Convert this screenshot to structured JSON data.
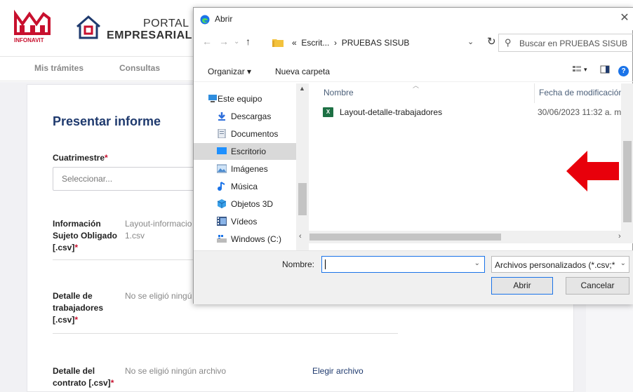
{
  "portal": {
    "title_line1": "PORTAL",
    "title_line2": "EMPRESARIAL",
    "logo_text": "INFONAVIT"
  },
  "nav": {
    "items": [
      "Mis trámites",
      "Consultas"
    ]
  },
  "form": {
    "title": "Presentar informe",
    "cuatrimestre_label": "Cuatrimestre",
    "cuatrimestre_placeholder": "Seleccionar...",
    "info_label_l1": "Información",
    "info_label_l2": "Sujeto Obligado",
    "info_label_l3": "[.csv]",
    "info_value_l1": "Layout-informacio",
    "info_value_l2": "1.csv",
    "detalle_trab_l1": "Detalle de",
    "detalle_trab_l2": "trabajadores",
    "detalle_trab_l3": "[.csv]",
    "detalle_trab_value": "No se eligió ningú",
    "detalle_contrato_l1": "Detalle del",
    "detalle_contrato_l2": "contrato [.csv]",
    "detalle_contrato_value": "No se eligió ningún archivo",
    "elegir_archivo": "Elegir archivo",
    "required_mark": "*"
  },
  "dialog": {
    "title": "Abrir",
    "close": "✕",
    "path_prefix": "«",
    "path_folder": "Escrit...",
    "path_sep": "›",
    "path_current": "PRUEBAS SISUB",
    "search_placeholder": "Buscar en PRUEBAS SISUB",
    "toolbar": {
      "organizar": "Organizar ▾",
      "nueva_carpeta": "Nueva carpeta",
      "help": "?"
    },
    "tree": [
      "Este equipo",
      "Descargas",
      "Documentos",
      "Escritorio",
      "Imágenes",
      "Música",
      "Objetos 3D",
      "Vídeos",
      "Windows (C:)"
    ],
    "columns": {
      "nombre": "Nombre",
      "fecha": "Fecha de modificación"
    },
    "files": [
      {
        "name": "Layout-detalle-trabajadores",
        "date": "30/06/2023 11:32 a. m"
      }
    ],
    "filename_label": "Nombre:",
    "filename_value": "",
    "filetype": "Archivos personalizados (*.csv;*",
    "open_button": "Abrir",
    "cancel_button": "Cancelar"
  },
  "colors": {
    "accent": "#1f3a6e",
    "required": "#c8102e",
    "highlight_arrow": "#e8000b",
    "dialog_focus": "#1a73e8"
  }
}
